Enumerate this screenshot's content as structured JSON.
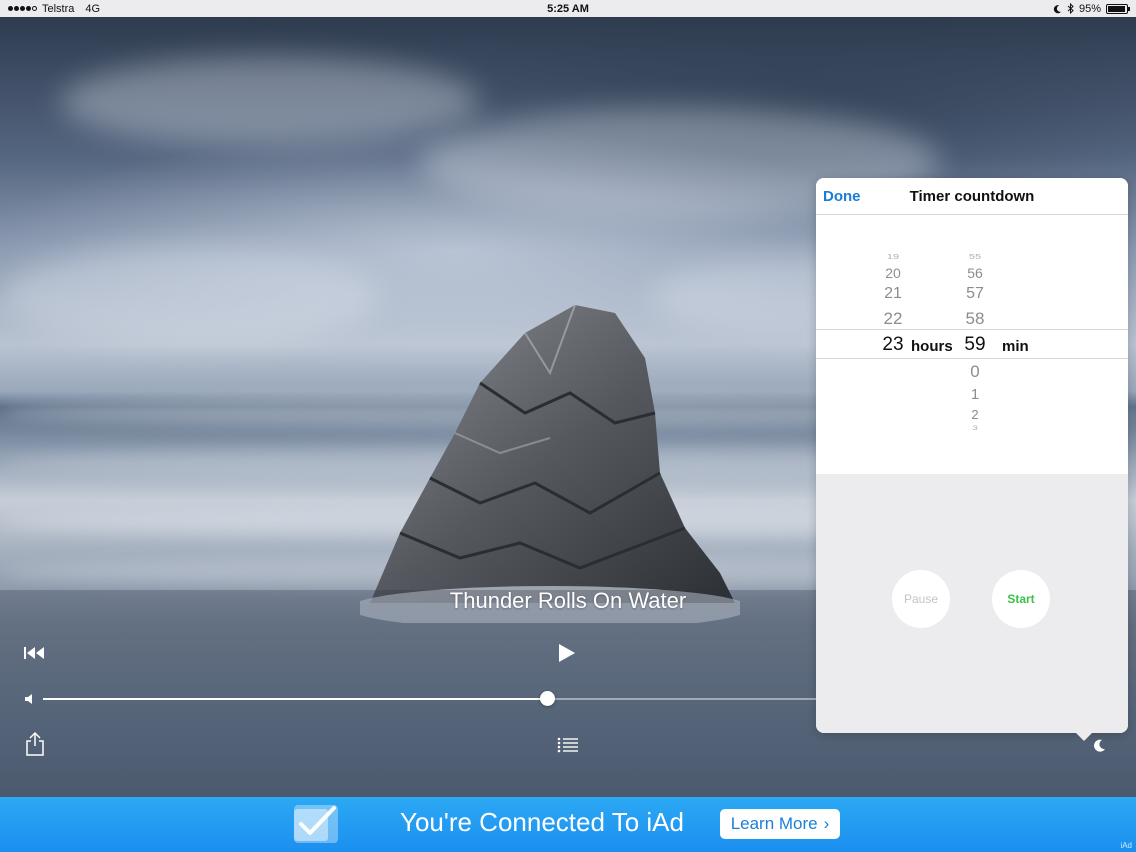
{
  "status_bar": {
    "carrier": "Telstra",
    "network": "4G",
    "time": "5:25 AM",
    "battery": "95%",
    "battery_level": 0.95,
    "icons": [
      "signal-dots-icon",
      "moon-icon",
      "bluetooth-icon",
      "battery-icon"
    ]
  },
  "player": {
    "track_title": "Thunder Rolls On Water",
    "volume_level": 0.48,
    "icons": [
      "previous-track-icon",
      "play-icon",
      "volume-icon",
      "share-icon",
      "playlist-icon",
      "sleep-timer-moon-icon"
    ]
  },
  "timer_popover": {
    "done_label": "Done",
    "title": "Timer countdown",
    "hours_unit": "hours",
    "minutes_unit": "min",
    "hours_values": [
      "19",
      "20",
      "21",
      "22",
      "23"
    ],
    "selected_hours": "23",
    "minutes_values": [
      "55",
      "56",
      "57",
      "58",
      "59",
      "0",
      "1",
      "2",
      "3"
    ],
    "selected_minutes": "59",
    "pause_label": "Pause",
    "start_label": "Start",
    "colors": {
      "accent": "#1a7cd6",
      "start": "#3bc14a"
    }
  },
  "ad_banner": {
    "message": "You're Connected To iAd",
    "button_label": "Learn More",
    "button_chevron": "›",
    "tag": "iAd",
    "color": "#2ca9f4"
  }
}
